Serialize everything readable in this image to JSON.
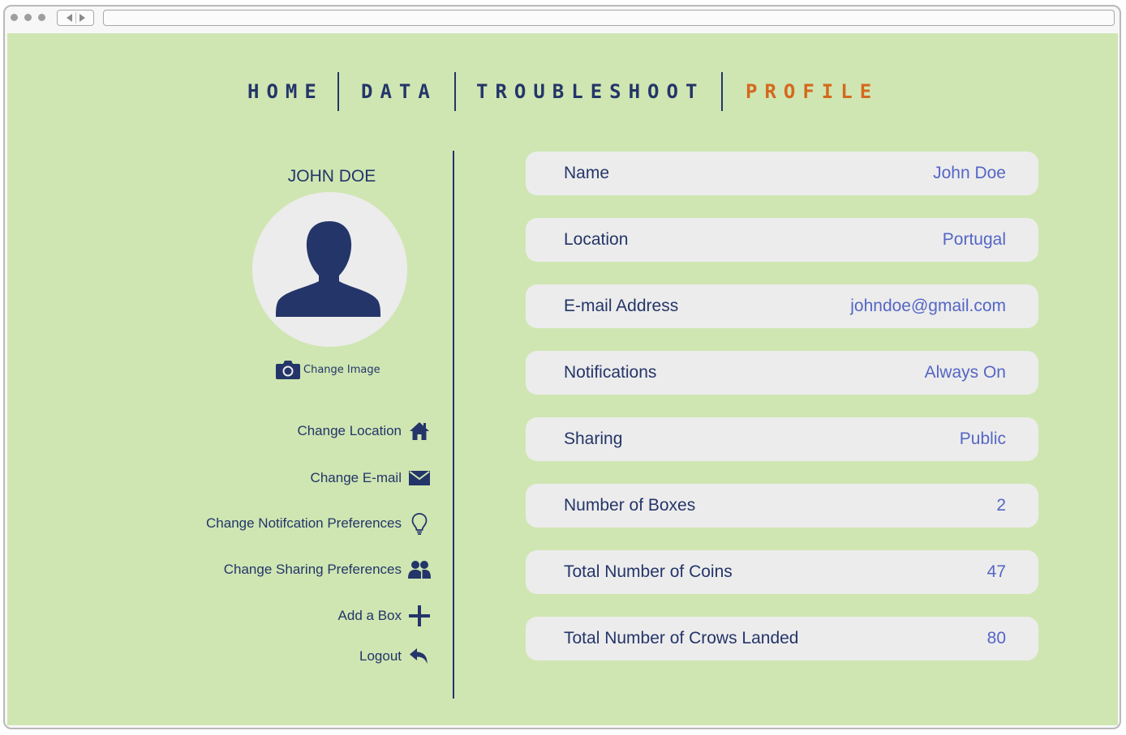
{
  "nav": {
    "items": [
      {
        "label": "HOME",
        "active": false
      },
      {
        "label": "DATA",
        "active": false
      },
      {
        "label": "TROUBLESHOOT",
        "active": false
      },
      {
        "label": "PROFILE",
        "active": true
      }
    ]
  },
  "profile": {
    "display_name": "JOHN DOE",
    "change_image_label": "Change Image",
    "actions": [
      {
        "label": "Change Location",
        "icon": "home-icon"
      },
      {
        "label": "Change E-mail",
        "icon": "envelope-icon"
      },
      {
        "label": "Change Notifcation Preferences",
        "icon": "lightbulb-icon"
      },
      {
        "label": "Change Sharing Preferences",
        "icon": "users-icon"
      },
      {
        "label": "Add a Box",
        "icon": "plus-icon"
      },
      {
        "label": "Logout",
        "icon": "reply-icon"
      }
    ]
  },
  "details": [
    {
      "label": "Name",
      "value": "John Doe"
    },
    {
      "label": "Location",
      "value": "Portugal"
    },
    {
      "label": "E-mail Address",
      "value": "johndoe@gmail.com"
    },
    {
      "label": "Notifications",
      "value": "Always On"
    },
    {
      "label": "Sharing",
      "value": "Public"
    },
    {
      "label": "Number of Boxes",
      "value": "2"
    },
    {
      "label": "Total Number of Coins",
      "value": "47"
    },
    {
      "label": "Total Number of Crows Landed",
      "value": "80"
    }
  ],
  "colors": {
    "background": "#cfe6b2",
    "primary": "#243569",
    "active_nav": "#d4691d",
    "value_text": "#5466c6",
    "card": "#ececec"
  }
}
